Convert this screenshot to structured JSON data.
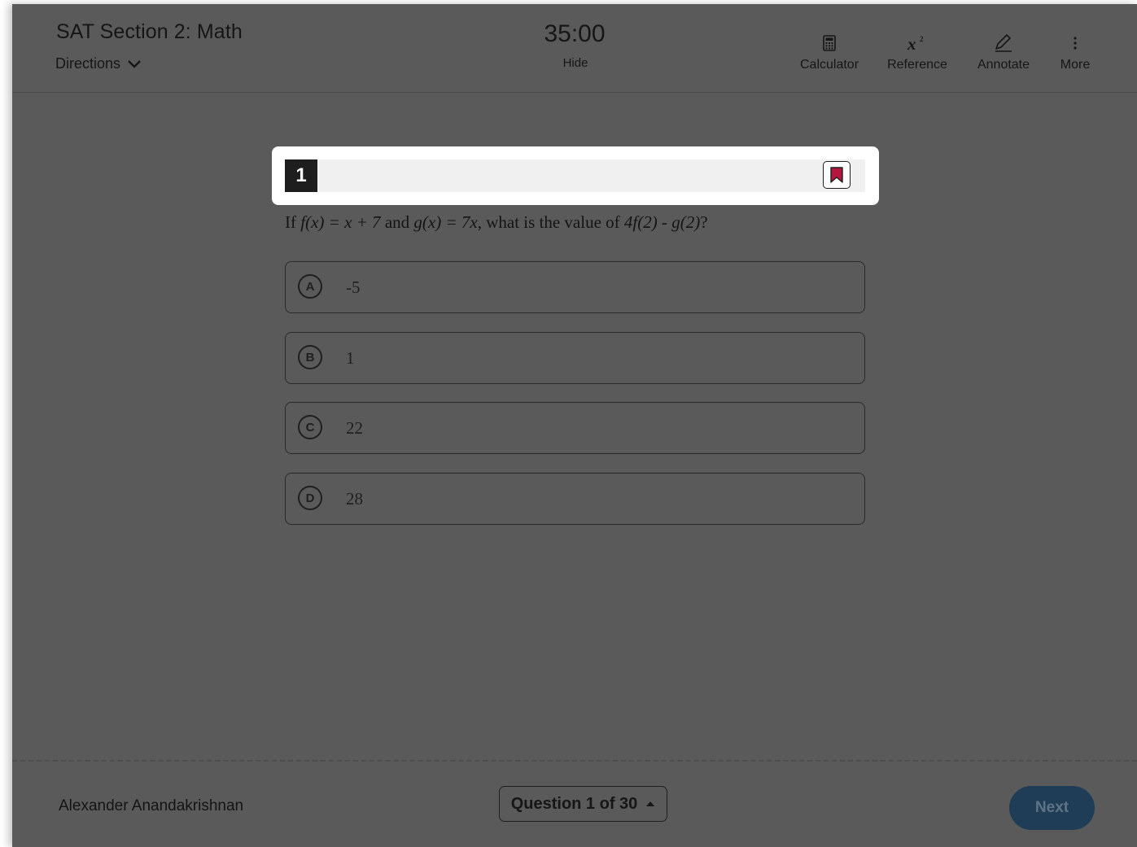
{
  "header": {
    "section_title": "SAT Section 2: Math",
    "directions_label": "Directions",
    "timer": "35:00",
    "hide_label": "Hide",
    "tools": {
      "calculator": "Calculator",
      "reference": "Reference",
      "annotate": "Annotate",
      "more": "More"
    }
  },
  "question": {
    "number": "1",
    "text_parts": {
      "p1": "If ",
      "f_expr": "f(x) = x + 7",
      "p2": " and ",
      "g_expr": "g(x) = 7x",
      "p3": ", what is the value of ",
      "target": "4f(2) - g(2)",
      "p4": "?"
    },
    "choices": [
      {
        "letter": "A",
        "text": "-5"
      },
      {
        "letter": "B",
        "text": "1"
      },
      {
        "letter": "C",
        "text": "22"
      },
      {
        "letter": "D",
        "text": "28"
      }
    ]
  },
  "footer": {
    "student_name": "Alexander Anandakrishnan",
    "question_nav": "Question 1 of 30",
    "next_label": "Next"
  },
  "icons": {
    "directions": "chevron-down-icon",
    "calculator": "calculator-icon",
    "reference": "superscript-icon",
    "annotate": "pencil-icon",
    "more": "more-vertical-icon",
    "bookmark": "bookmark-icon",
    "question_nav": "caret-up-icon"
  },
  "colors": {
    "overlay_background": "#5a5a5a",
    "bookmark_fill": "#b3173d",
    "next_button": "#1f3d57"
  }
}
